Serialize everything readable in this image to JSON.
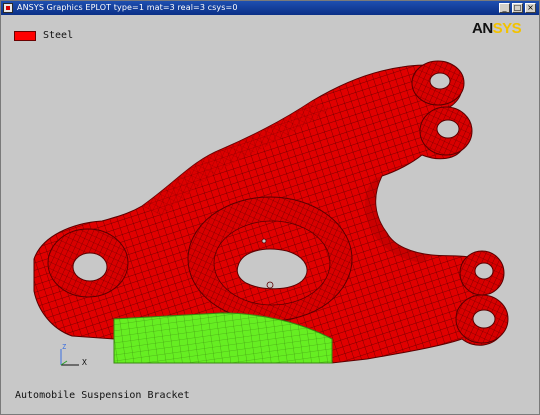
{
  "window": {
    "title": "ANSYS Graphics   EPLOT  type=1 mat=3 real=3 csys=0",
    "buttons": {
      "minimize": "_",
      "maximize": "□",
      "close": "×"
    }
  },
  "legend": {
    "label": "Steel",
    "color": "#ff0000"
  },
  "logo": {
    "part1": "AN",
    "part2": "SYS"
  },
  "triad": {
    "x_label": "X",
    "z_label": "Z"
  },
  "caption": "Automobile Suspension Bracket",
  "colors": {
    "background": "#c8c8c8",
    "steel": "#e00000",
    "mesh_lines": "#5a0000",
    "highlight_region": "#66ee22",
    "titlebar": "#0a2f86"
  },
  "icons": [
    "ansys-app-icon",
    "minimize-icon",
    "maximize-icon",
    "close-icon",
    "coordinate-triad-icon"
  ]
}
